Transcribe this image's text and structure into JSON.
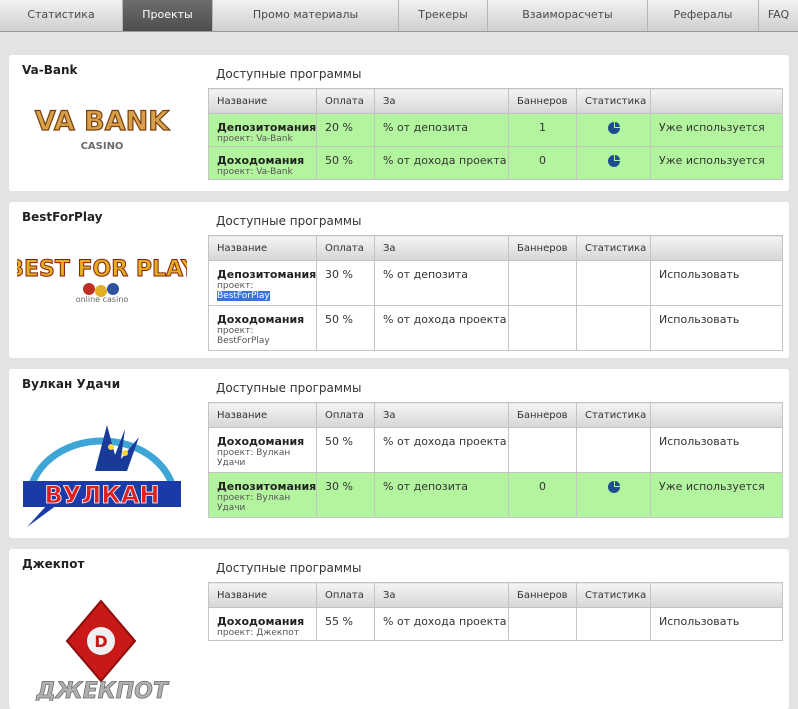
{
  "nav": [
    {
      "label": "Статистика"
    },
    {
      "label": "Проекты"
    },
    {
      "label": "Промо материалы"
    },
    {
      "label": "Трекеры"
    },
    {
      "label": "Взаиморасчеты"
    },
    {
      "label": "Рефералы"
    },
    {
      "label": "FAQ"
    }
  ],
  "columns": {
    "name": "Название",
    "pay": "Оплата",
    "for": "За",
    "banners": "Баннеров",
    "stats": "Статистика"
  },
  "available_label": "Доступные программы",
  "project_prefix": "проект:",
  "colors": {
    "used_row": "#b3f59f",
    "active_tab": "#5a5a5a",
    "link": "#3a5f92",
    "stat_icon": "#1f4e8c"
  },
  "projects": [
    {
      "name": "Va-Bank",
      "logo_text": "VA BANK",
      "logo_sub": "CASINO",
      "programs": [
        {
          "name": "Депозитомания",
          "project": "проект: Va-Bank",
          "pay": "20 %",
          "for": "% от депозита",
          "banners": "1",
          "stats_icon": "pie-chart-icon",
          "action": "Уже используется",
          "used": true
        },
        {
          "name": "Доходомания",
          "project": "проект: Va-Bank",
          "pay": "50 %",
          "for": "% от дохода проекта",
          "banners": "0",
          "stats_icon": "pie-chart-icon",
          "action": "Уже используется",
          "used": true
        }
      ]
    },
    {
      "name": "BestForPlay",
      "logo_text": "BEST FOR PLAY",
      "logo_sub": "online casino",
      "programs": [
        {
          "name": "Депозитомания",
          "project_label": "проект:",
          "project": "BestForPlay",
          "pay": "30 %",
          "for": "% от депозита",
          "banners": "",
          "action": "Использовать",
          "used": false
        },
        {
          "name": "Доходомания",
          "project_label": "проект:",
          "project": "BestForPlay",
          "pay": "50 %",
          "for": "% от дохода проекта",
          "banners": "",
          "action": "Использовать",
          "used": false
        }
      ]
    },
    {
      "name": "Вулкан Удачи",
      "logo_text": "ВУЛКАН",
      "programs": [
        {
          "name": "Доходомания",
          "project": "проект: Вулкан",
          "project2": "Удачи",
          "pay": "50 %",
          "for": "% от дохода проекта",
          "banners": "",
          "action": "Использовать",
          "used": false
        },
        {
          "name": "Депозитомания",
          "project": "проект: Вулкан",
          "project2": "Удачи",
          "pay": "30 %",
          "for": "% от депозита",
          "banners": "0",
          "stats_icon": "pie-chart-icon",
          "action": "Уже используется",
          "used": true
        }
      ]
    },
    {
      "name": "Джекпот",
      "logo_text": "ДЖЕКПОТ",
      "programs": [
        {
          "name": "Доходомания",
          "project": "проект: Джекпот",
          "pay": "55 %",
          "for": "% от дохода проекта",
          "banners": "",
          "action": "Использовать",
          "used": false
        }
      ]
    }
  ]
}
